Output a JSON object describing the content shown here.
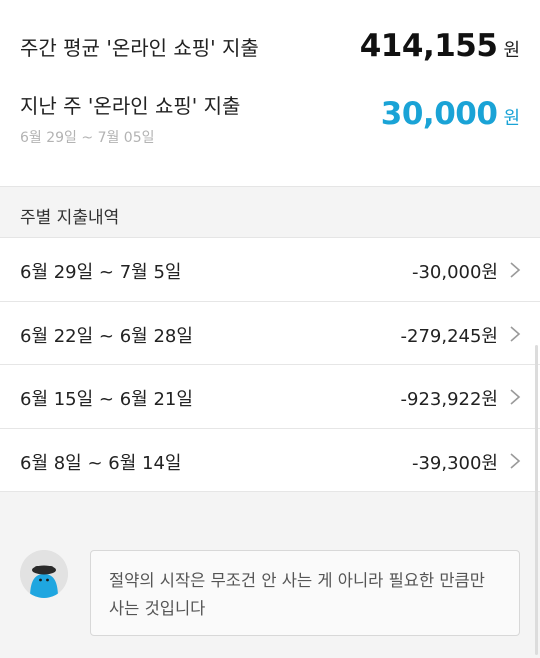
{
  "summary": {
    "weekly_avg_label": "주간 평균 '온라인 쇼핑' 지출",
    "weekly_avg_value": "414,155",
    "weekly_avg_unit": "원",
    "last_week_label": "지난 주 '온라인 쇼핑' 지출",
    "last_week_range": "6월 29일 ~ 7월 05일",
    "last_week_value": "30,000",
    "last_week_unit": "원",
    "accent_color": "#1aa3d6"
  },
  "weekly_section": {
    "title": "주별 지출내역",
    "rows": [
      {
        "range": "6월 29일 ~ 7월 5일",
        "amount": "-30,000원"
      },
      {
        "range": "6월 22일 ~ 6월 28일",
        "amount": "-279,245원"
      },
      {
        "range": "6월 15일 ~ 6월 21일",
        "amount": "-923,922원"
      },
      {
        "range": "6월 8일 ~ 6월 14일",
        "amount": "-39,300원"
      }
    ],
    "row_icon": "chevron-right-icon"
  },
  "tip": {
    "avatar_icon": "character-avatar-icon",
    "message": "절약의 시작은 무조건 안 사는 게 아니라 필요한 만큼만 사는 것입니다"
  }
}
